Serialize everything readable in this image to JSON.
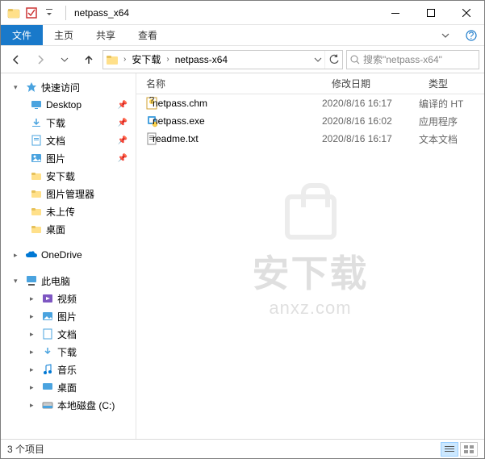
{
  "window": {
    "title": "netpass_x64",
    "folder_name": "netpass-x64"
  },
  "ribbon": {
    "file": "文件",
    "home": "主页",
    "share": "共享",
    "view": "查看"
  },
  "breadcrumb": {
    "seg1": "安下载",
    "seg2": "netpass-x64"
  },
  "search": {
    "placeholder": "搜索\"netpass-x64\""
  },
  "sidebar": {
    "quick_access": "快速访问",
    "desktop": "Desktop",
    "downloads": "下载",
    "documents": "文档",
    "pictures": "图片",
    "anxz": "安下载",
    "picmgr": "图片管理器",
    "not_uploaded": "未上传",
    "desktop2": "桌面",
    "onedrive": "OneDrive",
    "this_pc": "此电脑",
    "video": "视频",
    "pictures2": "图片",
    "documents2": "文档",
    "downloads2": "下载",
    "music": "音乐",
    "desktop3": "桌面",
    "local_disk": "本地磁盘 (C:)"
  },
  "columns": {
    "name": "名称",
    "date": "修改日期",
    "type": "类型"
  },
  "files": [
    {
      "name": "netpass.chm",
      "date": "2020/8/16 16:17",
      "type": "编译的 HT",
      "icon": "chm"
    },
    {
      "name": "netpass.exe",
      "date": "2020/8/16 16:02",
      "type": "应用程序",
      "icon": "exe"
    },
    {
      "name": "readme.txt",
      "date": "2020/8/16 16:17",
      "type": "文本文档",
      "icon": "txt"
    }
  ],
  "status": {
    "count": "3 个项目"
  },
  "watermark": {
    "text": "安下载",
    "sub": "anxz.com"
  }
}
